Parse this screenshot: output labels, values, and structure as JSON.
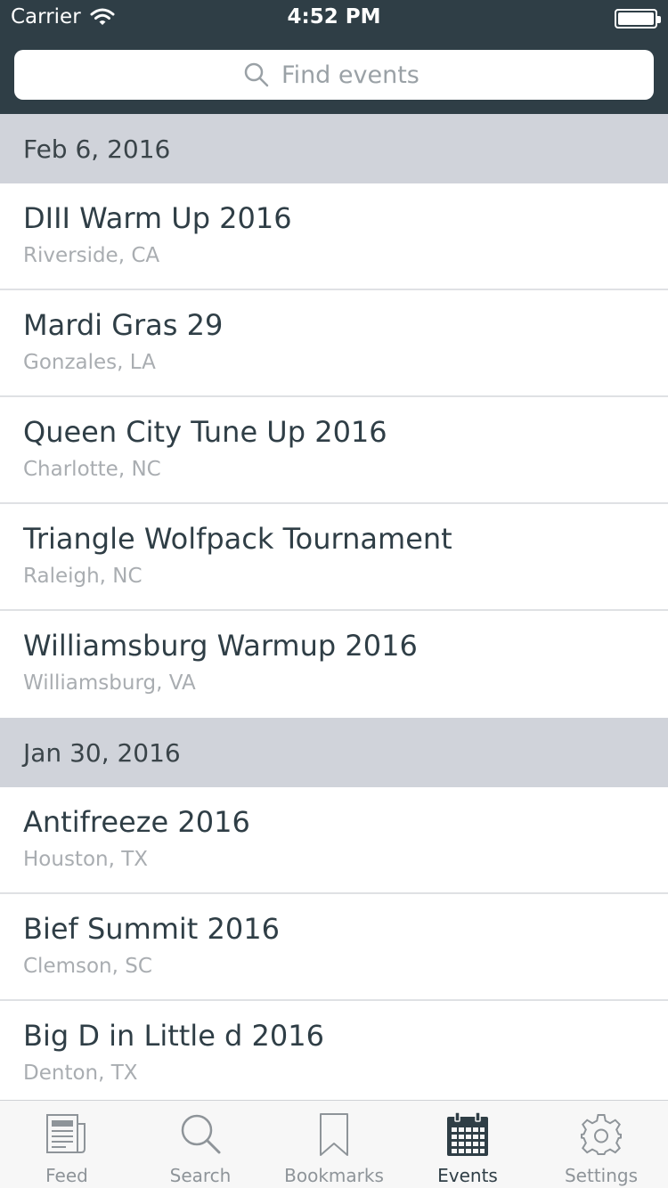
{
  "status_bar": {
    "carrier": "Carrier",
    "time": "4:52 PM"
  },
  "search": {
    "placeholder": "Find events"
  },
  "sections": [
    {
      "date": "Feb 6, 2016",
      "events": [
        {
          "title": "DIII Warm Up 2016",
          "location": "Riverside, CA"
        },
        {
          "title": "Mardi Gras 29",
          "location": "Gonzales, LA"
        },
        {
          "title": "Queen City Tune Up 2016",
          "location": "Charlotte, NC"
        },
        {
          "title": "Triangle Wolfpack Tournament",
          "location": "Raleigh, NC"
        },
        {
          "title": "Williamsburg Warmup 2016",
          "location": "Williamsburg, VA"
        }
      ]
    },
    {
      "date": "Jan 30, 2016",
      "events": [
        {
          "title": "Antifreeze 2016",
          "location": "Houston, TX"
        },
        {
          "title": "Bief Summit 2016",
          "location": "Clemson, SC"
        },
        {
          "title": "Big D in Little d 2016",
          "location": "Denton, TX"
        }
      ]
    }
  ],
  "tabs": [
    {
      "label": "Feed",
      "icon": "newspaper-icon",
      "active": false
    },
    {
      "label": "Search",
      "icon": "magnifier-icon",
      "active": false
    },
    {
      "label": "Bookmarks",
      "icon": "bookmark-icon",
      "active": false
    },
    {
      "label": "Events",
      "icon": "calendar-icon",
      "active": true
    },
    {
      "label": "Settings",
      "icon": "gear-icon",
      "active": false
    }
  ],
  "colors": {
    "header_bg": "#2f3e46",
    "section_bg": "#d0d3da",
    "active_tab": "#2f3e46",
    "inactive_tab": "#8e9499"
  }
}
